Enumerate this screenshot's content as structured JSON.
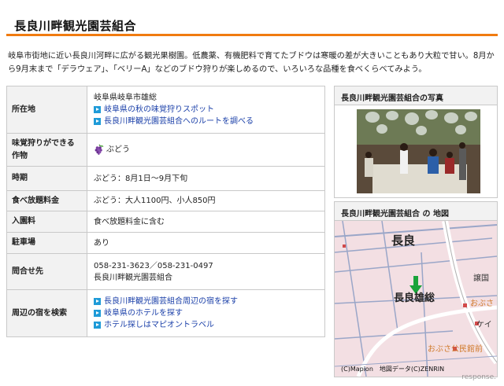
{
  "page": {
    "title": "長良川畔観光園芸組合",
    "intro": "岐阜市街地に近い長良川河畔に広がる観光果樹園。低農薬、有機肥料で育てたブドウは寒暖の差が大きいこともあり大粒で甘い。8月から9月末まで「デラウェア」、「ベリーA」などのブドウ狩りが楽しめるので、いろいろな品種を食べくらべてみよう。"
  },
  "info": {
    "location": {
      "label": "所在地",
      "address": "岐阜県岐阜市雄総",
      "links": [
        "岐阜県の秋の味覚狩りスポット",
        "長良川畔観光園芸組合へのルートを調べる"
      ]
    },
    "fruit": {
      "label": "味覚狩りができる作物",
      "value": "ぶどう"
    },
    "season": {
      "label": "時期",
      "value": "ぶどう：8月1日～9月下旬"
    },
    "price": {
      "label": "食べ放題料金",
      "value": "ぶどう：大人1100円、小人850円"
    },
    "entry": {
      "label": "入園料",
      "value": "食べ放題料金に含む"
    },
    "parking": {
      "label": "駐車場",
      "value": "あり"
    },
    "contact": {
      "label": "問合せ先",
      "phone": "058-231-3623／058-231-0497",
      "name": "長良川畔観光園芸組合"
    },
    "lodging": {
      "label": "周辺の宿を検索",
      "links": [
        "長良川畔観光園芸組合周辺の宿を探す",
        "岐阜県のホテルを探す",
        "ホテル探しはマピオントラベル"
      ]
    }
  },
  "photo_panel": {
    "title": "長良川畔観光園芸組合の写真"
  },
  "map_panel": {
    "title": "長良川畔観光園芸組合 の 地図",
    "labels": {
      "area1": "長良",
      "area2": "長良雄総",
      "small1": "おぶさ",
      "small2": "おぶさ公民館前",
      "small3": "ケイ",
      "small4": "譲国"
    },
    "copyright": "(C)Mapion　地図データ(C)ZENRIN"
  },
  "watermark": "response.",
  "colors": {
    "accent": "#f07b10",
    "link": "#1a3fa8",
    "arrow": "#1f9bd8",
    "map_bg": "#f3dfe3",
    "marker": "#1aa33a"
  }
}
